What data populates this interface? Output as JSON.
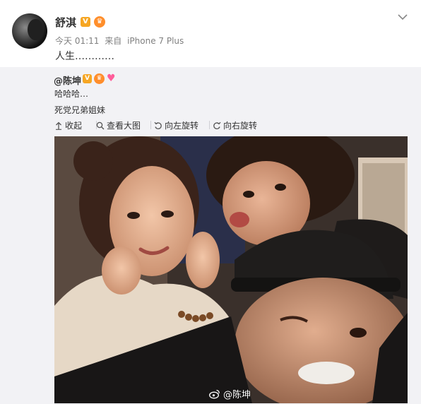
{
  "post": {
    "username": "舒淇",
    "verified_badge": "V",
    "meta": {
      "time": "今天 01:11",
      "source_prefix": "来自",
      "device": "iPhone 7 Plus"
    },
    "text": "人生…………"
  },
  "repost": {
    "username": "@陈坤",
    "verified_badge": "V",
    "line1": "哈哈哈…",
    "line2": "死党兄弟姐妹",
    "toolbar": {
      "collapse": "收起",
      "view_large": "查看大图",
      "rotate_left": "向左旋转",
      "rotate_right": "向右旋转"
    },
    "watermark": "@陈坤"
  },
  "colors": {
    "accent": "#f6a623",
    "repost_bg": "#f2f2f5",
    "meta": "#808080"
  }
}
